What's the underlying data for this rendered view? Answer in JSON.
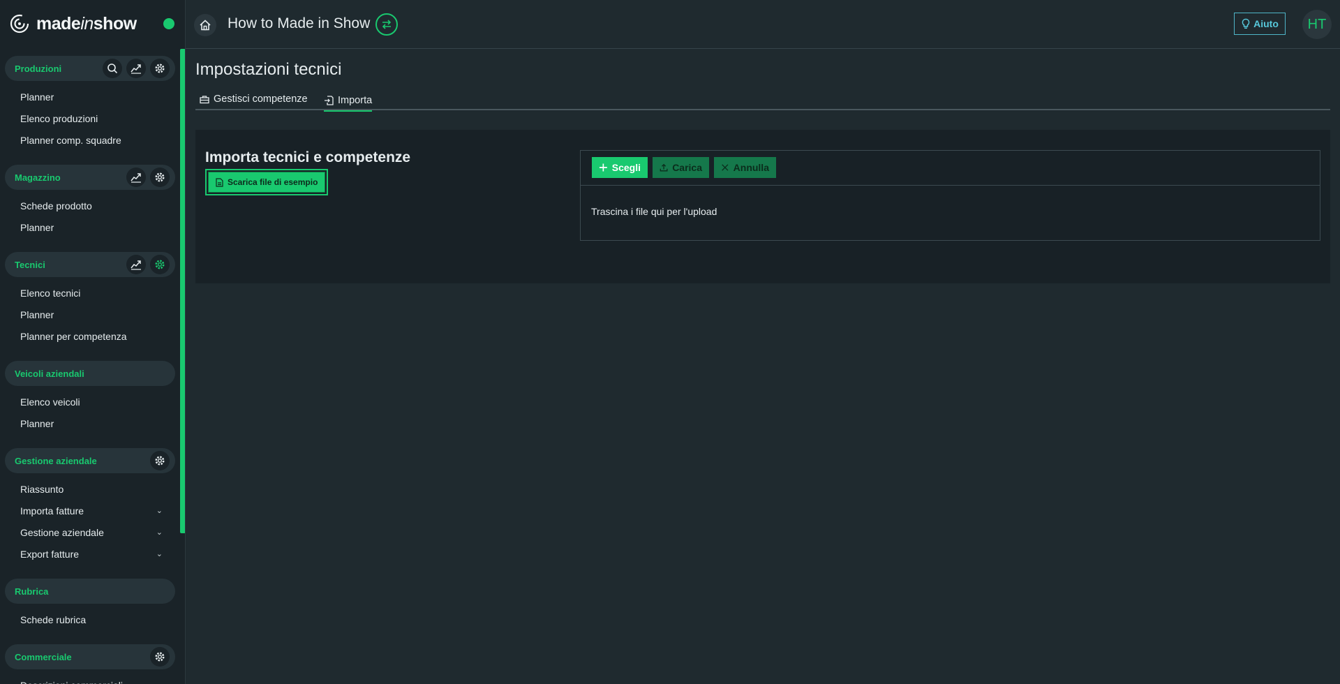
{
  "brand": {
    "name_prefix": "made",
    "name_italic": "in",
    "name_suffix": "show"
  },
  "header": {
    "title": "How to Made in Show",
    "help_label": "Aiuto",
    "avatar_initials": "HT"
  },
  "sidebar": {
    "sections": [
      {
        "title": "Produzioni",
        "icons": [
          "search-icon",
          "chart-icon",
          "gear-icon"
        ],
        "items": [
          "Planner",
          "Elenco produzioni",
          "Planner comp. squadre"
        ]
      },
      {
        "title": "Magazzino",
        "icons": [
          "chart-icon",
          "gear-icon"
        ],
        "items": [
          "Schede prodotto",
          "Planner"
        ]
      },
      {
        "title": "Tecnici",
        "icons": [
          "chart-icon",
          "gear-icon"
        ],
        "items": [
          "Elenco tecnici",
          "Planner",
          "Planner per competenza"
        ]
      },
      {
        "title": "Veicoli aziendali",
        "icons": [],
        "items": [
          "Elenco veicoli",
          "Planner"
        ]
      },
      {
        "title": "Gestione aziendale",
        "icons": [
          "gear-icon"
        ],
        "items": [
          "Riassunto",
          "Importa fatture",
          "Gestione aziendale",
          "Export fatture"
        ]
      },
      {
        "title": "Rubrica",
        "icons": [],
        "items": [
          "Schede rubrica"
        ]
      },
      {
        "title": "Commerciale",
        "icons": [
          "gear-icon"
        ],
        "items": [
          "Descrizioni commerciali"
        ]
      }
    ]
  },
  "main": {
    "page_title": "Impostazioni tecnici",
    "tabs": [
      {
        "label": "Gestisci competenze"
      },
      {
        "label": "Importa"
      }
    ],
    "active_tab": "Importa",
    "panel": {
      "title": "Importa tecnici e competenze",
      "sample_button": "Scarica file di esempio",
      "upload": {
        "choose_label": "Scegli",
        "upload_label": "Carica",
        "cancel_label": "Annulla",
        "drop_text": "Trascina i file qui per l'upload"
      }
    }
  },
  "colors": {
    "accent": "#19c96f",
    "help": "#57c8db",
    "background": "#1f2a2f",
    "sidebar": "#1a2328"
  }
}
